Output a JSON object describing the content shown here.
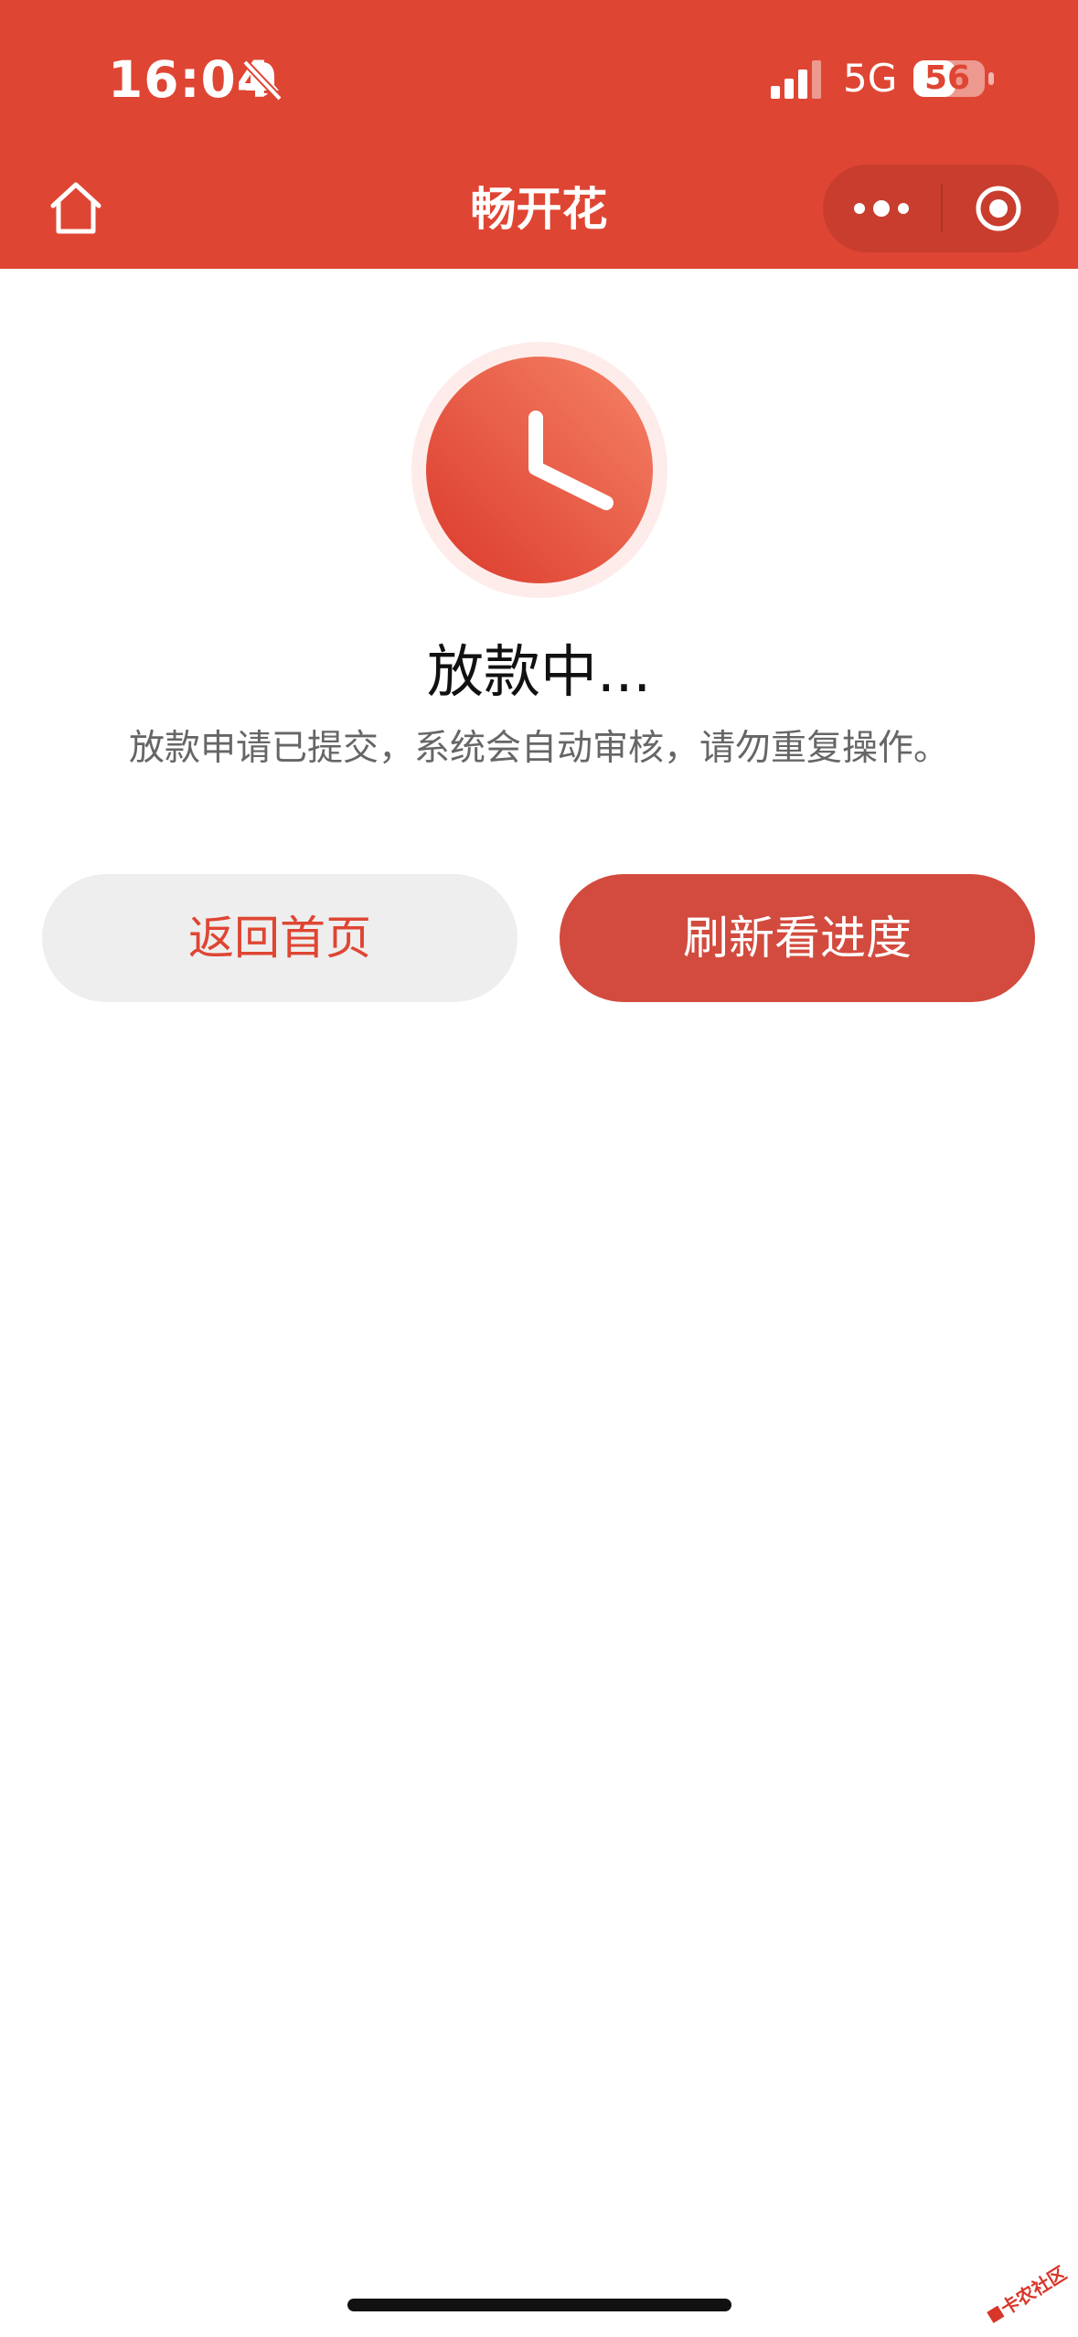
{
  "status_bar": {
    "time": "16:04",
    "network": "5G",
    "battery": "56"
  },
  "nav": {
    "title": "畅开花"
  },
  "status": {
    "title": "放款中...",
    "description": "放款申请已提交，系统会自动审核，请勿重复操作。"
  },
  "buttons": {
    "back_label": "返回首页",
    "refresh_label": "刷新看进度"
  },
  "watermark": {
    "text": "卡农社区"
  },
  "colors": {
    "brand": "#DF4533",
    "button_primary": "#D24B3E",
    "button_secondary": "#EEEEEE"
  },
  "icons": [
    "bell-muted-icon",
    "signal-icon",
    "battery-icon",
    "home-icon",
    "more-icon",
    "close-icon",
    "clock-icon"
  ]
}
